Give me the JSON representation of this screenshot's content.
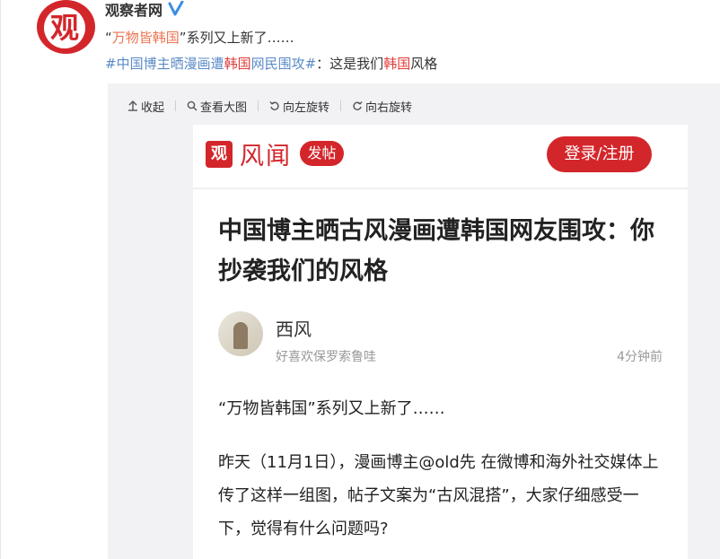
{
  "weibo": {
    "author": "观察者网",
    "avatar_glyph": "观",
    "verified_icon": "verified-v-icon",
    "text_line1": {
      "quote_open": "“",
      "highlight": "万物皆韩国",
      "quote_close": "”",
      "rest": "系列又上新了……"
    },
    "text_line2": {
      "hashtag_a": "#中国博主晒漫画遭",
      "hashtag_red": "韩国",
      "hashtag_b": "网民围攻#",
      "plain_a": "：这是我们",
      "plain_red": "韩国",
      "plain_b": "风格"
    }
  },
  "toolbar": {
    "collapse": "收起",
    "view_large": "查看大图",
    "rotate_left": "向左旋转",
    "rotate_right": "向右旋转"
  },
  "screenshot": {
    "logo_glyph": "观",
    "brand": "风闻",
    "post_pill": "发帖",
    "login": "登录/注册",
    "title": "中国博主晒古风漫画遭韩国网友围攻：你抄袭我们的风格",
    "writer": "西风",
    "bio": "好喜欢保罗索鲁哇",
    "time": "4分钟前",
    "lead": "“万物皆韩国”系列又上新了……",
    "body": "昨天（11月1日），漫画博主@old先 在微博和海外社交媒体上传了这样一组图，帖子文案为“古风混搭”，大家仔细感受一下，觉得有什么问题吗?"
  },
  "colors": {
    "brand_red": "#d3262b",
    "link_blue": "#5a8ac6",
    "quote_orange": "#eb7350"
  }
}
